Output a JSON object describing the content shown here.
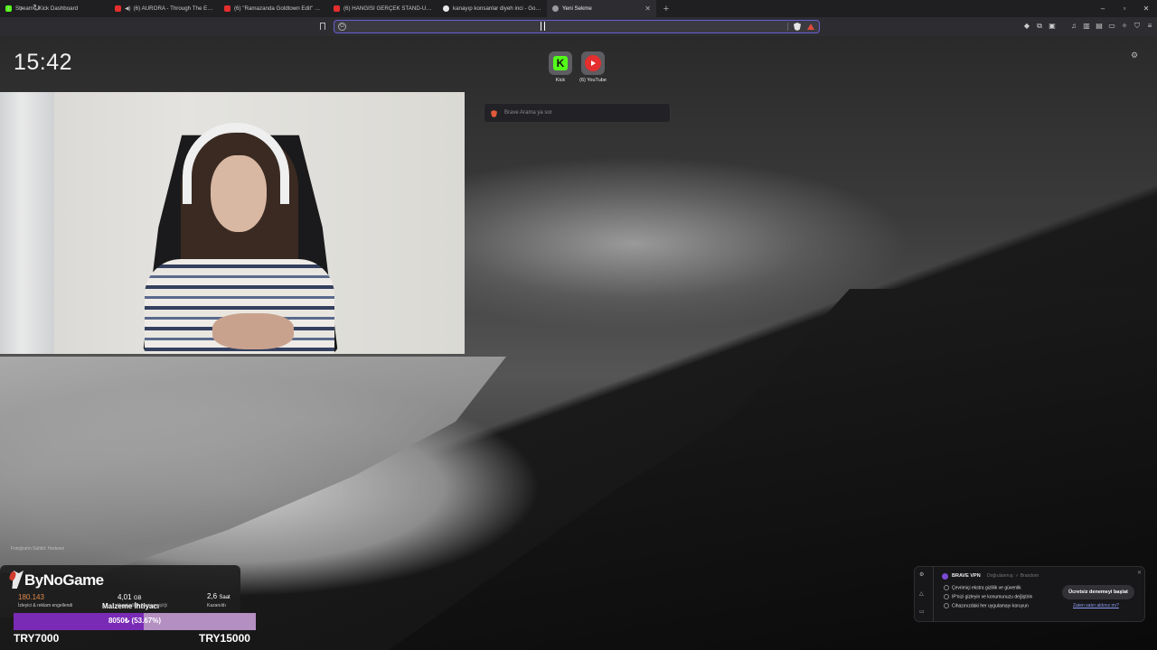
{
  "browser": {
    "tabs": [
      {
        "title": "Stream - Kick Dashboard",
        "favicon_color": "#53fc18",
        "audio": false,
        "active": false
      },
      {
        "title": "(6) AURORA - Through The Eyes",
        "favicon_color": "#e52e2e",
        "audio": true,
        "active": false
      },
      {
        "title": "(6) \"Ramazanda Goldtown Edit\" Kick",
        "favicon_color": "#e52e2e",
        "audio": false,
        "active": false
      },
      {
        "title": "(6) HANGİSİ GERÇEK STAND-UP KO",
        "favicon_color": "#e52e2e",
        "audio": false,
        "active": false
      },
      {
        "title": "kanayıp konsanlar diyeh inci - Google",
        "favicon_color": "#e8e8e8",
        "audio": false,
        "active": false
      },
      {
        "title": "Yeni Sekme",
        "favicon_color": "#9a9aa0",
        "audio": false,
        "active": true
      }
    ],
    "new_tab_symbol": "+",
    "window_controls": {
      "minimize": "–",
      "maximize": "▫",
      "close": "✕"
    },
    "address_bar": {
      "value": "",
      "engine_icon": "G"
    },
    "nav": {
      "back": "‹",
      "forward": "›",
      "reload": "↻"
    }
  },
  "new_tab_page": {
    "clock": "15:42",
    "shortcuts": [
      {
        "label": "Kick",
        "icon": "kick-icon"
      },
      {
        "label": "(6) YouTube",
        "icon": "youtube-icon"
      }
    ],
    "search_placeholder": "Brave Arama ya sor",
    "photo_credit": "Fotoğrafın Sahibi: Hedewé"
  },
  "stream_overlay": {
    "channel": "ByNoGame",
    "stats": [
      {
        "value": "180.143",
        "label": "İzleyici & reklam engellendi"
      },
      {
        "value": "4,01",
        "unit": "GB",
        "label": "Kaydedilen bant genişliği"
      },
      {
        "value": "2,6",
        "unit": "Saat",
        "label": "Kazanıldı"
      }
    ],
    "goal": {
      "title": "Malzeme İhtiyacı",
      "progress_text": "8050₺ (53.67%)",
      "progress_fraction": 0.5367,
      "min": "TRY7000",
      "max": "TRY15000"
    }
  },
  "vpn_card": {
    "title": "BRAVE VPN",
    "sponsor": "Doğrulanmış: ✓ Brandom",
    "items": [
      "Çevrimiçi ekstra gizlilik ve güvenlik",
      "IP'nizi gizleyin ve konumunuzu değiştirin",
      "Cihazınızdaki her uygulamayı koruyun"
    ],
    "cta": "Ücretsiz denemeyi başlat",
    "link": "Zaten satın aldınız mı?",
    "accent": "#7a4ad4"
  },
  "colors": {
    "tab_bar": "#1f1f22",
    "toolbar": "#2d2d31",
    "url_focus": "#6a5bd6",
    "goal_fill": "#7a2bb5",
    "goal_track": "#b48fc2"
  }
}
